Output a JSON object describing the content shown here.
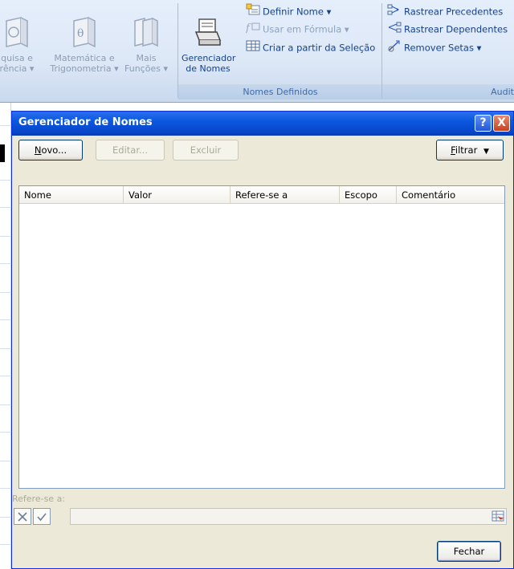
{
  "ribbon": {
    "function_library": {
      "lookup_label_1": "quisa e",
      "lookup_label_2": "rência",
      "math_label_1": "Matemática e",
      "math_label_2": "Trigonometria",
      "more_label_1": "Mais",
      "more_label_2": "Funções"
    },
    "defined_names": {
      "name_manager_label_1": "Gerenciador",
      "name_manager_label_2": "de Nomes",
      "define_name": "Definir Nome",
      "use_in_formula": "Usar em Fórmula",
      "create_from_selection": "Criar a partir da Seleção",
      "group_title": "Nomes Definidos"
    },
    "auditing": {
      "trace_precedents": "Rastrear Precedentes",
      "trace_dependents": "Rastrear Dependentes",
      "remove_arrows": "Remover Setas",
      "group_title": "Audit"
    }
  },
  "dialog": {
    "title": "Gerenciador de Nomes",
    "help": "?",
    "close": "X",
    "buttons": {
      "new_pre": "N",
      "new_post": "ovo...",
      "edit": "Editar...",
      "delete": "Excluir",
      "filter_pre": "F",
      "filter_post": "iltrar"
    },
    "columns": [
      "Nome",
      "Valor",
      "Refere-se a",
      "Escopo",
      "Comentário"
    ],
    "refers_to_label": "Refere-se a:",
    "close_button": "Fechar"
  },
  "colors": {
    "title_bar": "#0a58e0",
    "dialog_bg": "#ece9d8",
    "ribbon_bg": "#dde8f7",
    "ribbon_text": "#15428b"
  }
}
